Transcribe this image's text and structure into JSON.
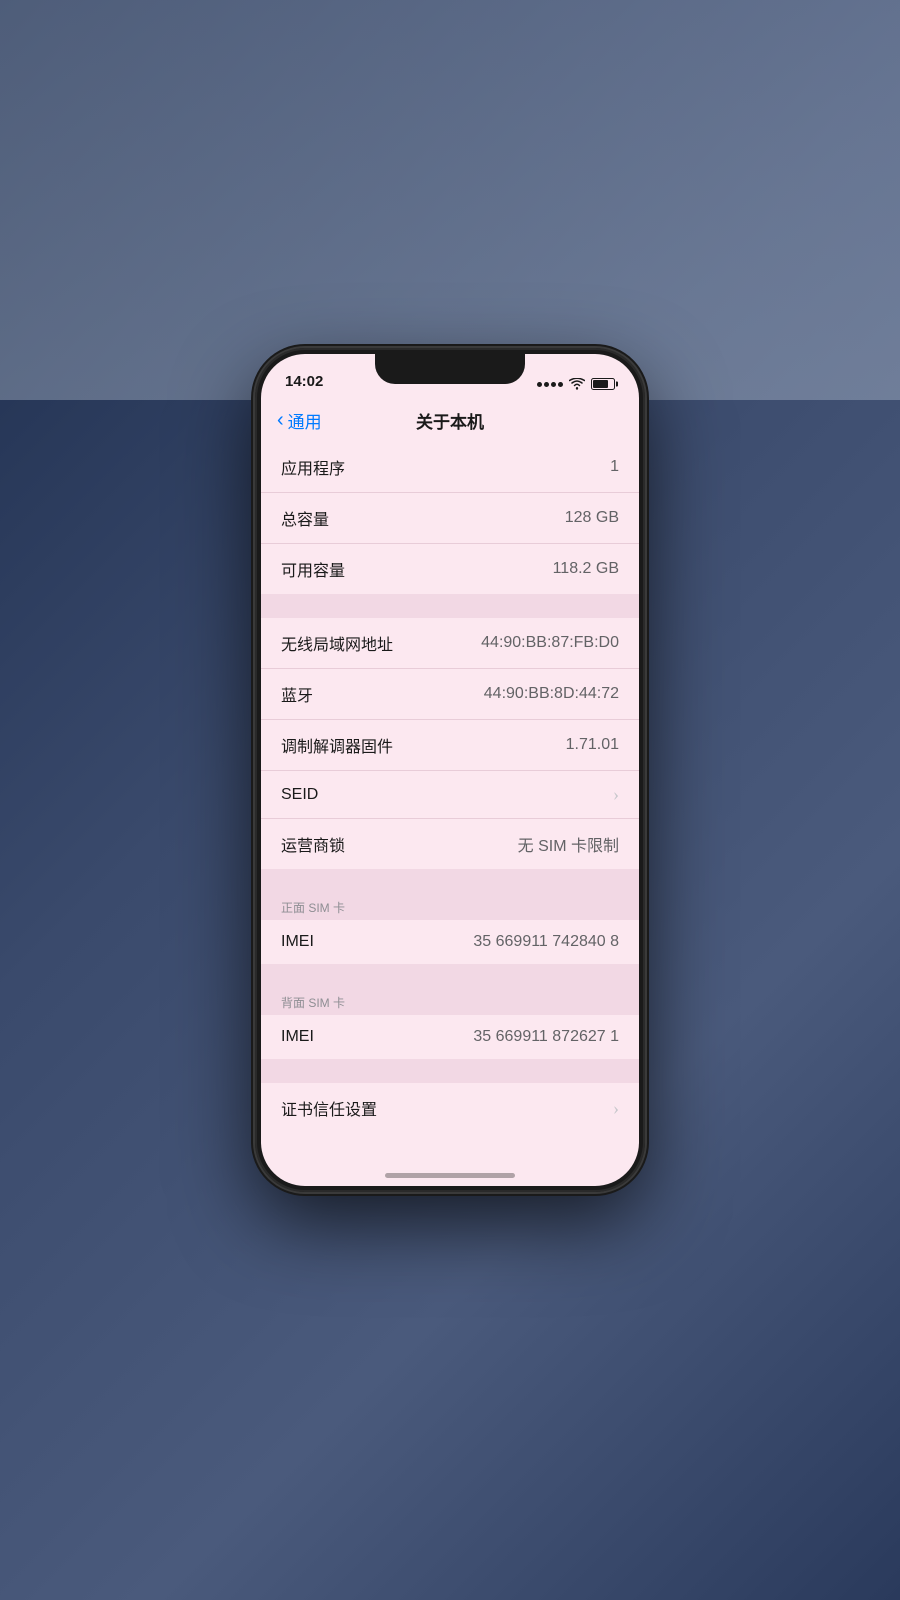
{
  "background": {
    "color": "#2a3a5c"
  },
  "status_bar": {
    "time": "14:02",
    "battery_pct": 70
  },
  "nav": {
    "back_label": "通用",
    "title": "关于本机"
  },
  "groups": [
    {
      "id": "group-main",
      "header": null,
      "rows": [
        {
          "id": "apps",
          "label": "应用程序",
          "value": "1",
          "chevron": false
        },
        {
          "id": "capacity",
          "label": "总容量",
          "value": "128 GB",
          "chevron": false
        },
        {
          "id": "available",
          "label": "可用容量",
          "value": "118.2 GB",
          "chevron": false
        }
      ]
    },
    {
      "id": "group-network",
      "header": null,
      "rows": [
        {
          "id": "wifi-mac",
          "label": "无线局域网地址",
          "value": "44:90:BB:87:FB:D0",
          "chevron": false
        },
        {
          "id": "bluetooth",
          "label": "蓝牙",
          "value": "44:90:BB:8D:44:72",
          "chevron": false
        },
        {
          "id": "modem",
          "label": "调制解调器固件",
          "value": "1.71.01",
          "chevron": false
        },
        {
          "id": "seid",
          "label": "SEID",
          "value": "",
          "chevron": true
        },
        {
          "id": "carrier",
          "label": "运营商锁",
          "value": "无 SIM 卡限制",
          "chevron": false
        }
      ]
    },
    {
      "id": "group-sim-front",
      "header": "正面 SIM 卡",
      "rows": [
        {
          "id": "imei-front",
          "label": "IMEI",
          "value": "35 669911 742840 8",
          "chevron": false
        }
      ]
    },
    {
      "id": "group-sim-back",
      "header": "背面 SIM 卡",
      "rows": [
        {
          "id": "imei-back",
          "label": "IMEI",
          "value": "35 669911 872627 1",
          "chevron": false
        }
      ]
    },
    {
      "id": "group-cert",
      "header": null,
      "rows": [
        {
          "id": "cert",
          "label": "证书信任设置",
          "value": "",
          "chevron": true
        }
      ]
    }
  ],
  "home_indicator": true
}
